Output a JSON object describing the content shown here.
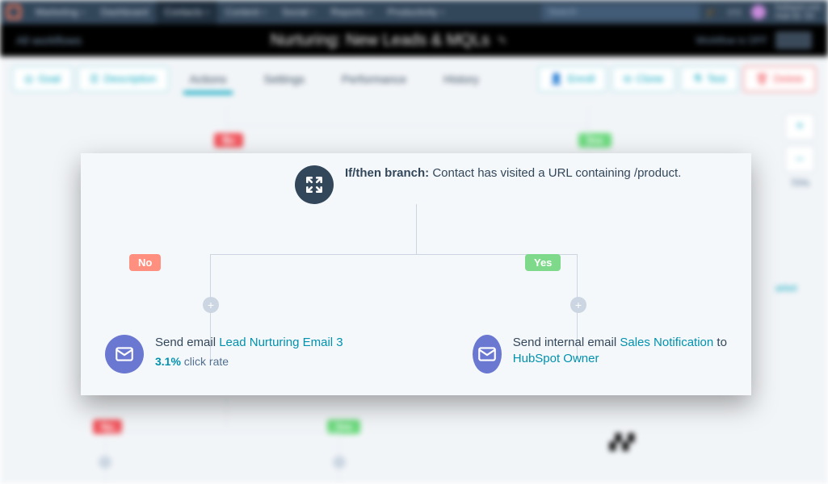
{
  "topnav": {
    "brand": "Marketing",
    "items": [
      "Dashboard",
      "Contacts",
      "Content",
      "Social",
      "Reports",
      "Productivity"
    ],
    "active_index": 1,
    "search_placeholder": "Search",
    "account_domain": "hubspot.com",
    "account_hub": "Hub ID: 53"
  },
  "subbar": {
    "breadcrumb": "All workflows",
    "title": "Nurturing: New Leads & MQLs",
    "status": "Workflow is OFF"
  },
  "toolbar": {
    "goal": "Goal",
    "description": "Description",
    "tabs": [
      "Actions",
      "Settings",
      "Performance",
      "History"
    ],
    "active_tab": 0,
    "enroll": "Enroll",
    "clone": "Clone",
    "test": "Test",
    "delete": "Delete"
  },
  "zoom": {
    "plus": "+",
    "minus": "–",
    "level": "70%"
  },
  "bg_labels": {
    "no": "No",
    "yes": "Yes"
  },
  "branch": {
    "label": "If/then branch:",
    "text_a": " Contact has visited a URL containing ",
    "path": "/product",
    "text_b": "."
  },
  "labels": {
    "no": "No",
    "yes": "Yes"
  },
  "no_leaf": {
    "prefix": "Send email ",
    "link": "Lead Nurturing Email 3",
    "rate": "3.1%",
    "rate_suffix": " click rate"
  },
  "yes_leaf": {
    "prefix": "Send internal email ",
    "link1": "Sales Notification",
    "mid": " to ",
    "link2": "HubSpot Owner"
  }
}
